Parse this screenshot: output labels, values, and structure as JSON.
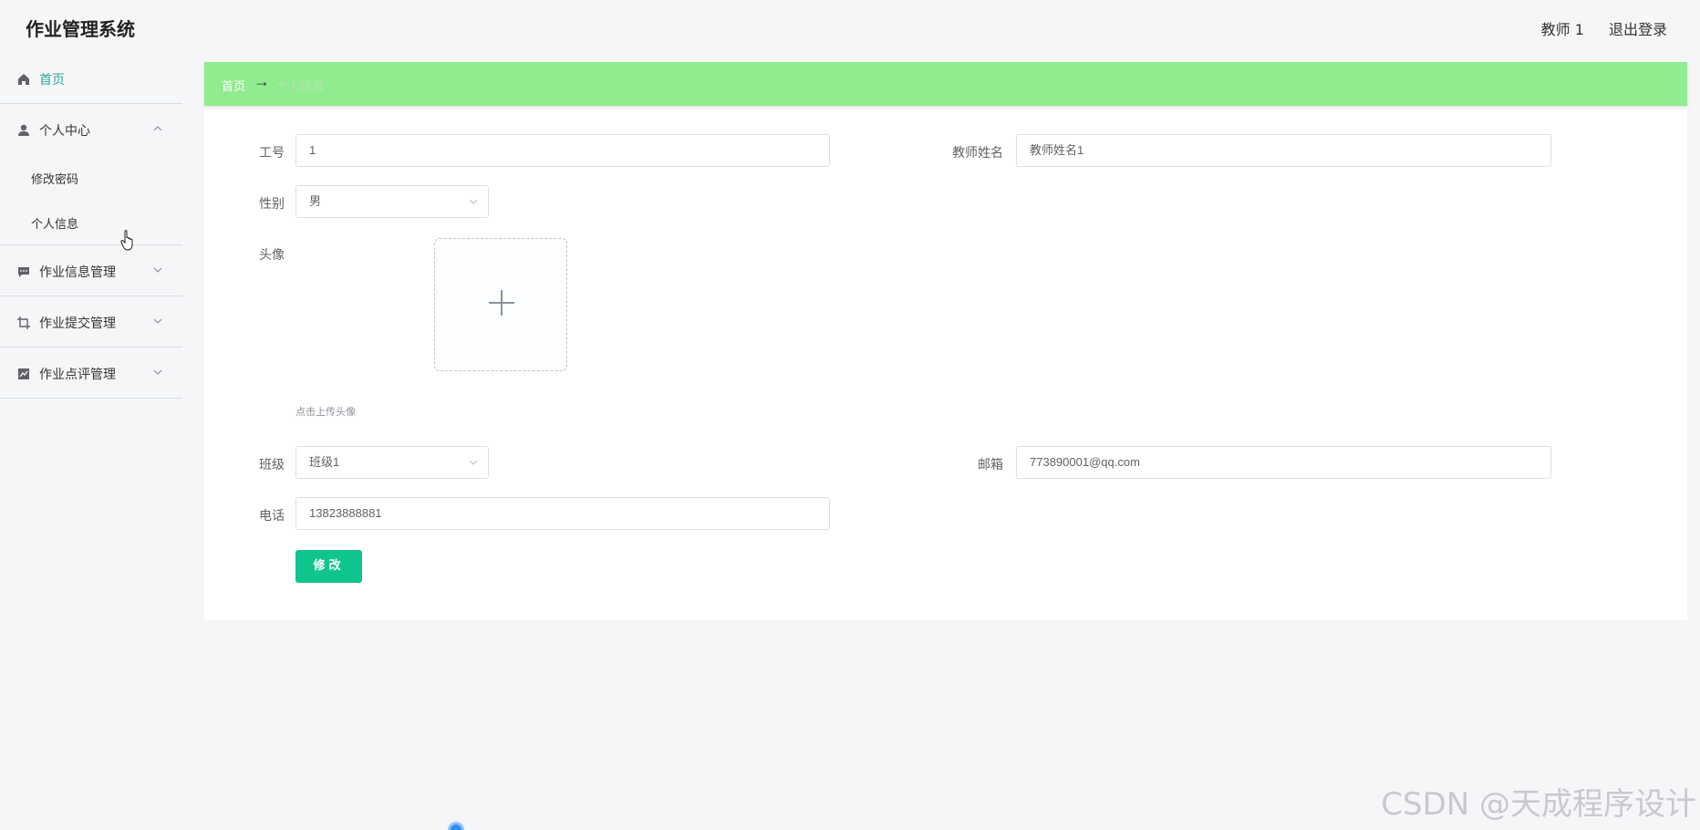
{
  "app": {
    "title": "作业管理系统"
  },
  "header": {
    "user": "教师 1",
    "logout": "退出登录"
  },
  "sidebar": {
    "home": "首页",
    "personal_center": "个人中心",
    "personal_items": [
      "修改密码",
      "个人信息"
    ],
    "homework_info": "作业信息管理",
    "homework_submit": "作业提交管理",
    "homework_review": "作业点评管理"
  },
  "breadcrumb": {
    "home": "首页",
    "arrow": "→",
    "current": "个人信息"
  },
  "form": {
    "job_no_label": "工号",
    "job_no_value": "1",
    "teacher_name_label": "教师姓名",
    "teacher_name_value": "教师姓名1",
    "gender_label": "性别",
    "gender_value": "男",
    "avatar_label": "头像",
    "avatar_tip": "点击上传头像",
    "class_label": "班级",
    "class_value": "班级1",
    "email_label": "邮箱",
    "email_value": "773890001@qq.com",
    "phone_label": "电话",
    "phone_value": "13823888881",
    "submit": "修改"
  },
  "watermark": "CSDN @天成程序设计",
  "colors": {
    "accent": "#31a89b",
    "breadcrumb_bg": "#90ec8e",
    "button": "#0fc48d"
  }
}
